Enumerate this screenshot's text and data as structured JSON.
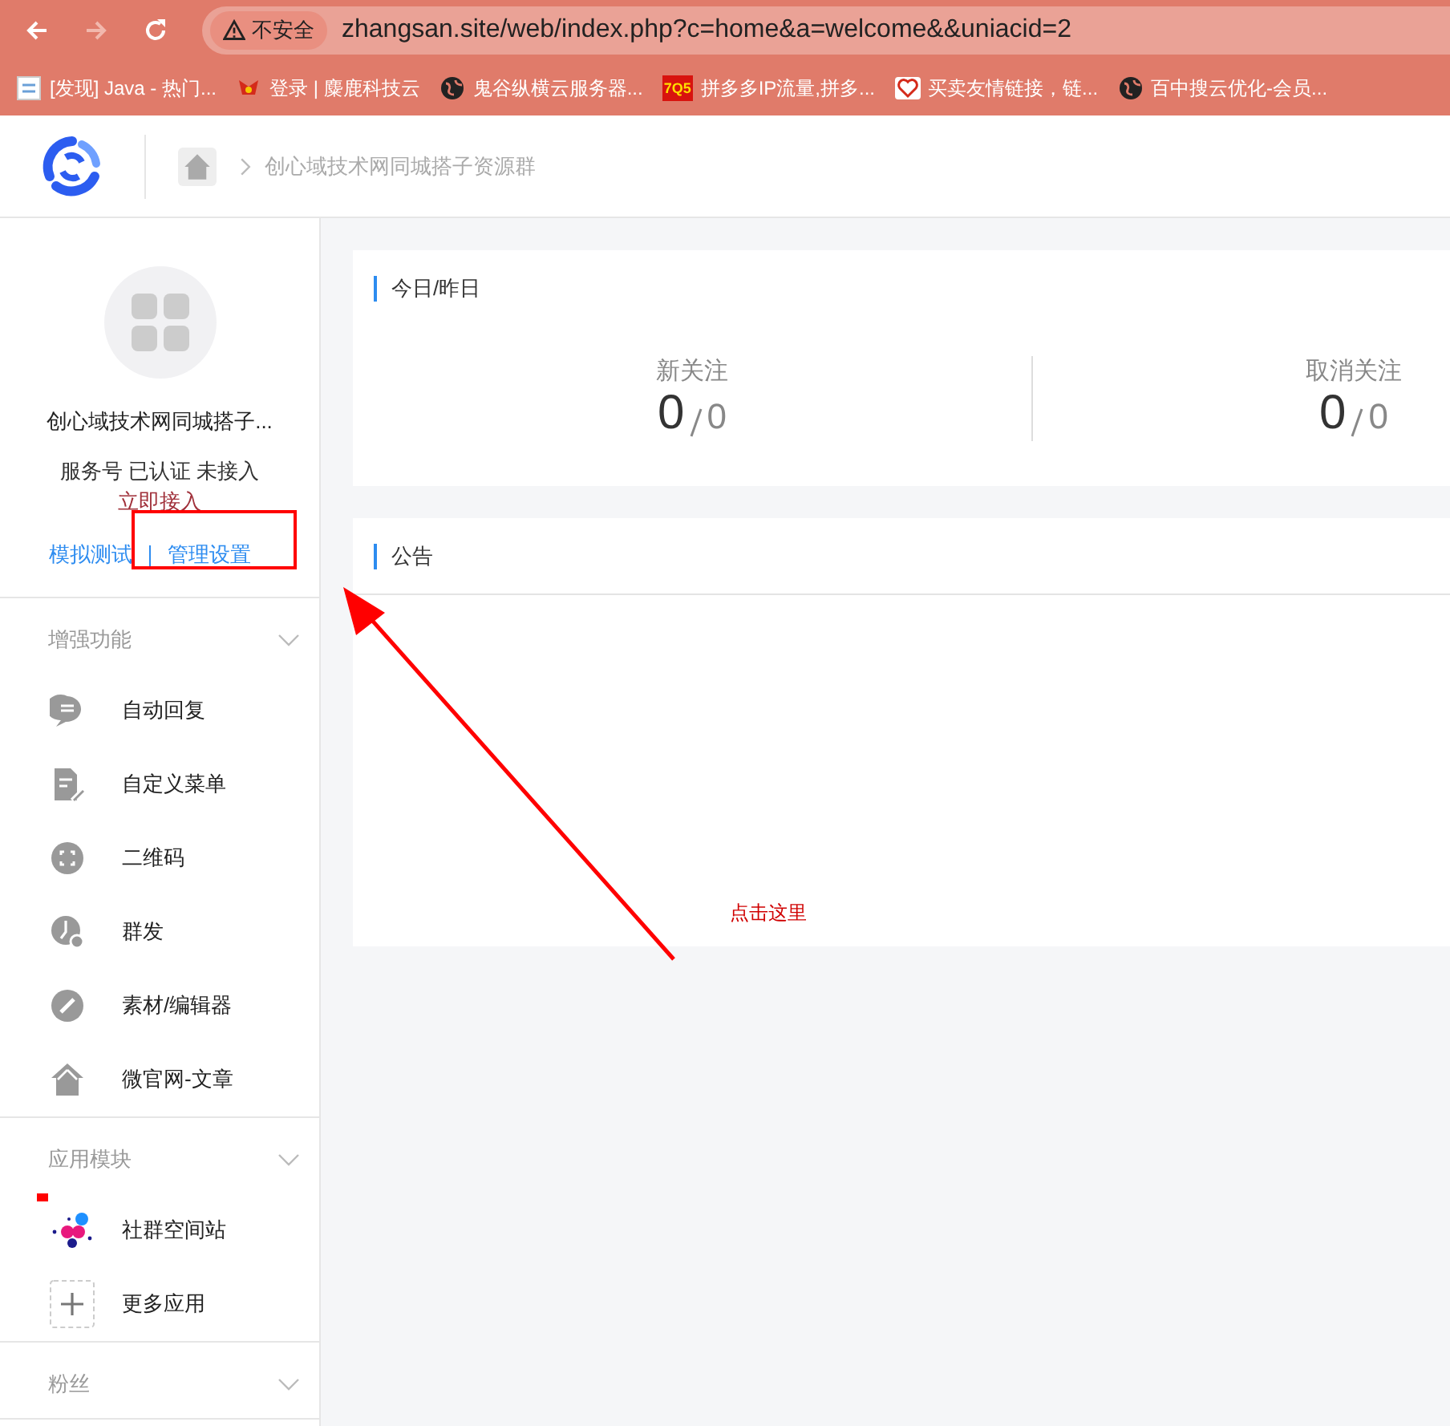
{
  "browser": {
    "security_label": "不安全",
    "url": "zhangsan.site/web/index.php?c=home&a=welcome&&uniacid=2",
    "bookmarks": [
      {
        "kind": "doc",
        "label": "[发现] Java - 热门..."
      },
      {
        "kind": "bird",
        "label": "登录 | 麋鹿科技云"
      },
      {
        "kind": "globe",
        "label": "鬼谷纵横云服务器..."
      },
      {
        "kind": "badge",
        "badge": "7Q5",
        "label": "拼多多IP流量,拼多..."
      },
      {
        "kind": "heart",
        "label": "买卖友情链接，链..."
      },
      {
        "kind": "globe",
        "label": "百中搜云优化-会员..."
      }
    ]
  },
  "header": {
    "breadcrumb": "创心域技术网同城搭子资源群"
  },
  "account": {
    "name": "创心域技术网同城搭子...",
    "status": "服务号 已认证 未接入",
    "action": "立即接入",
    "links": [
      {
        "label": "模拟测试",
        "highlighted": false
      },
      {
        "label": "管理设置",
        "highlighted": true
      }
    ]
  },
  "sidebar": {
    "sections": [
      {
        "title": "增强功能",
        "items": [
          {
            "kind": "chat",
            "label": "自动回复"
          },
          {
            "kind": "doc",
            "label": "自定义菜单"
          },
          {
            "kind": "qr",
            "label": "二维码"
          },
          {
            "kind": "clock",
            "label": "群发"
          },
          {
            "kind": "pen",
            "label": "素材/编辑器"
          },
          {
            "kind": "home",
            "label": "微官网-文章"
          }
        ]
      },
      {
        "title": "应用模块",
        "items": [
          {
            "kind": "dots",
            "label": "社群空间站",
            "flag": true
          },
          {
            "kind": "plus",
            "label": "更多应用"
          }
        ]
      },
      {
        "title": "粉丝"
      }
    ]
  },
  "stats_card": {
    "title": "今日/昨日",
    "stats": [
      {
        "label": "新关注",
        "today": "0",
        "yesterday": "0"
      },
      {
        "label": "取消关注",
        "today": "0",
        "yesterday": "0"
      }
    ]
  },
  "notice_card": {
    "title": "公告"
  },
  "annotation": {
    "text": "点击这里"
  }
}
